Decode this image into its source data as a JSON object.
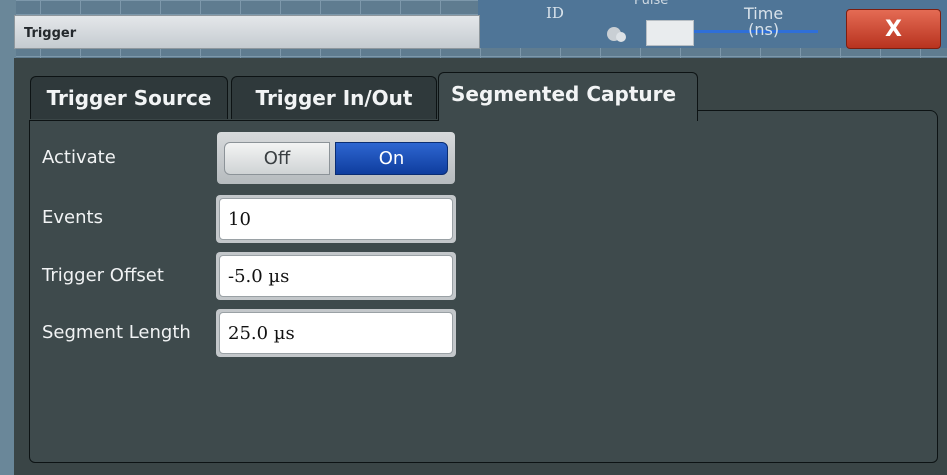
{
  "background": {
    "id_label": "ID",
    "pulse_label": "Pulse",
    "time_label": "Time",
    "time_unit": "(ns)"
  },
  "window": {
    "title": "Trigger",
    "close_label": "X"
  },
  "tabs": [
    {
      "label": "Trigger Source",
      "active": false
    },
    {
      "label": "Trigger In/Out",
      "active": false
    },
    {
      "label": "Segmented Capture",
      "active": true
    }
  ],
  "form": {
    "activate": {
      "label": "Activate",
      "off_label": "Off",
      "on_label": "On",
      "selected": "On"
    },
    "events": {
      "label": "Events",
      "value": "10"
    },
    "trigger_offset": {
      "label": "Trigger Offset",
      "value": "-5.0 µs"
    },
    "segment_length": {
      "label": "Segment Length",
      "value": "25.0 µs"
    }
  },
  "colors": {
    "toggle_on": "#1b4fb5",
    "close_button": "#c9432d",
    "panel_background": "#3e4a4c"
  }
}
